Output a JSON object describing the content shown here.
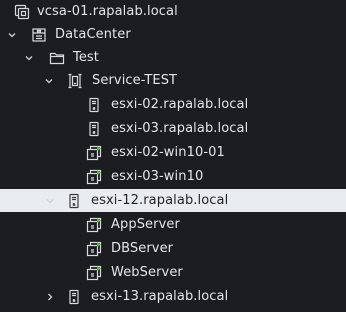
{
  "tree": {
    "nodes": [
      {
        "label": "vcsa-01.rapalab.local",
        "icon": "vcenter-icon",
        "expand": "none",
        "selected": false
      },
      {
        "label": "DataCenter",
        "icon": "datacenter-icon",
        "expand": "expanded",
        "selected": false
      },
      {
        "label": "Test",
        "icon": "folder-icon",
        "expand": "expanded",
        "selected": false
      },
      {
        "label": "Service-TEST",
        "icon": "cluster-icon",
        "expand": "expanded",
        "selected": false
      },
      {
        "label": "esxi-02.rapalab.local",
        "icon": "host-icon",
        "expand": "none",
        "selected": false
      },
      {
        "label": "esxi-03.rapalab.local",
        "icon": "host-icon",
        "expand": "none",
        "selected": false
      },
      {
        "label": "esxi-02-win10-01",
        "icon": "vm-powered-on-icon",
        "expand": "none",
        "selected": false
      },
      {
        "label": "esxi-03-win10",
        "icon": "vm-powered-on-icon",
        "expand": "none",
        "selected": false
      },
      {
        "label": "esxi-12.rapalab.local",
        "icon": "host-icon",
        "expand": "expanded",
        "selected": true
      },
      {
        "label": "AppServer",
        "icon": "vm-powered-on-icon",
        "expand": "none",
        "selected": false
      },
      {
        "label": "DBServer",
        "icon": "vm-powered-on-icon",
        "expand": "none",
        "selected": false
      },
      {
        "label": "WebServer",
        "icon": "vm-powered-on-icon",
        "expand": "none",
        "selected": false
      },
      {
        "label": "esxi-13.rapalab.local",
        "icon": "host-icon",
        "expand": "collapsed",
        "selected": false
      }
    ]
  },
  "colors": {
    "background": "#1c1d20",
    "text": "#e3e5e8",
    "selected_background": "#e9ecee",
    "selected_text": "#1f2123",
    "vm_power_on": "#5dbb3b"
  }
}
